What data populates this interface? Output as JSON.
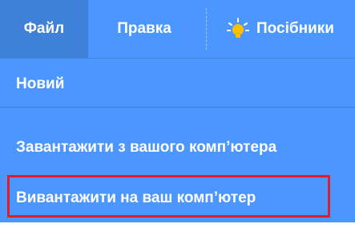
{
  "menubar": {
    "file_label": "Файл",
    "edit_label": "Правка",
    "tutorials_label": "Посібники",
    "tutorials_icon": "lightbulb-icon"
  },
  "file_menu": {
    "items": [
      {
        "label": "Новий"
      },
      {
        "label": "Завантажити з вашого комп’ютера"
      },
      {
        "label": "Вивантажити на ваш комп’ютер"
      }
    ]
  },
  "colors": {
    "menu_blue": "#4c97ff",
    "active_blue": "#3f80d9",
    "highlight_red": "#e21d2b"
  }
}
